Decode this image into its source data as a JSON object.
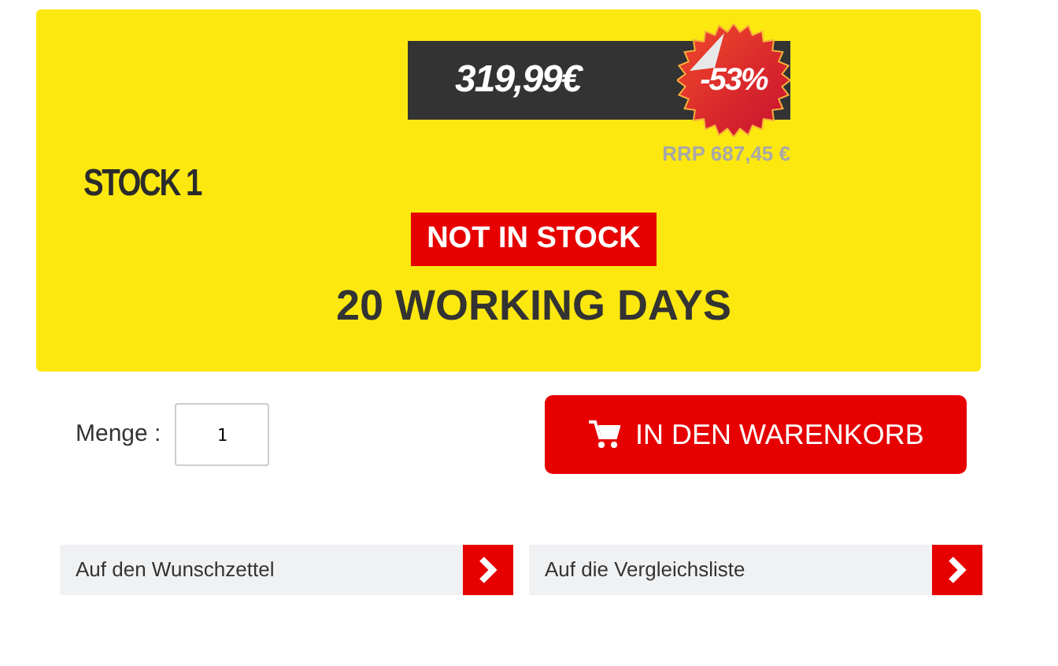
{
  "product": {
    "stock_label": "STOCK 1",
    "price": "319,99€",
    "discount_badge": "-53%",
    "rrp": "RRP 687,45 €",
    "availability": "NOT IN STOCK",
    "delivery": "20 WORKING DAYS"
  },
  "quantity": {
    "label": "Menge :",
    "value": "1"
  },
  "cart_button": {
    "label": "IN DEN WARENKORB"
  },
  "links": [
    {
      "label": "Auf den Wunschzettel"
    },
    {
      "label": "Auf die Vergleichsliste"
    }
  ]
}
